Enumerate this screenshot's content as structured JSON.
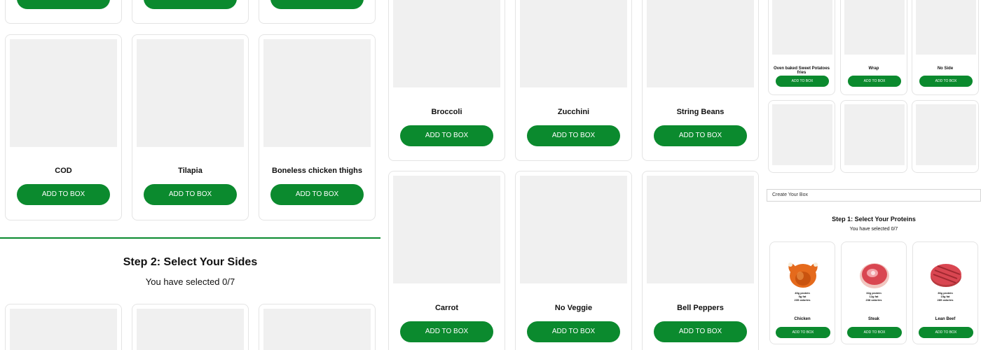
{
  "add_label": "ADD TO BOX",
  "left": {
    "proteins_row": [
      "COD",
      "Tilapia",
      "Boneless chicken thighs"
    ],
    "step2": {
      "title": "Step 2: Select Your Sides",
      "selected": "You have selected 0/7"
    }
  },
  "middle": {
    "veggies_row1": [
      "Broccoli",
      "Zucchini",
      "String Beans"
    ],
    "veggies_row2": [
      "Carrot",
      "No Veggie",
      "Bell Peppers"
    ]
  },
  "right": {
    "sides_row": [
      "Oven baked Sweet Potatoes fries",
      "Wrap",
      "No Side"
    ],
    "create_box_input": "Create Your Box",
    "step1": {
      "title": "Step 1: Select Your Proteins",
      "selected": "You have selected 0/7"
    },
    "proteins": [
      {
        "name": "Chicken",
        "icon": "chicken-icon",
        "nutrition": [
          "40g protein",
          "5g fat",
          "235 calories"
        ]
      },
      {
        "name": "Steak",
        "icon": "steak-icon",
        "nutrition": [
          "32g protein",
          "12g fat",
          "238 calories"
        ]
      },
      {
        "name": "Lean Beef",
        "icon": "lean-beef-icon",
        "nutrition": [
          "36g protein",
          "15g fat",
          "289 calories"
        ]
      }
    ]
  },
  "colors": {
    "accent": "#0b8a2e",
    "placeholder": "#f0f0f0"
  }
}
